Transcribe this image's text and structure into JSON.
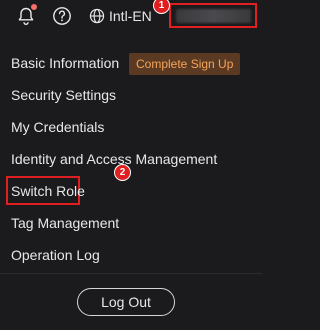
{
  "topbar": {
    "language_label": "Intl-EN",
    "notification_icon": "bell-icon",
    "help_icon": "question-circle-icon",
    "language_icon": "globe-icon",
    "has_notification_dot": true
  },
  "user_menu": {
    "items": [
      {
        "label": "Basic Information"
      },
      {
        "label": "Security Settings"
      },
      {
        "label": "My Credentials"
      },
      {
        "label": "Identity and Access Management"
      },
      {
        "label": "Switch Role"
      },
      {
        "label": "Tag Management"
      },
      {
        "label": "Operation Log"
      }
    ],
    "signup_badge_label": "Complete Sign Up",
    "logout_label": "Log Out"
  },
  "annotations": {
    "step_1": "1",
    "step_2": "2",
    "highlight_color": "#e02020"
  },
  "colors": {
    "background": "#1b1b1d",
    "badge_bg": "#5a3a22",
    "badge_text": "#f6a45a",
    "text": "#e8e8e8"
  }
}
